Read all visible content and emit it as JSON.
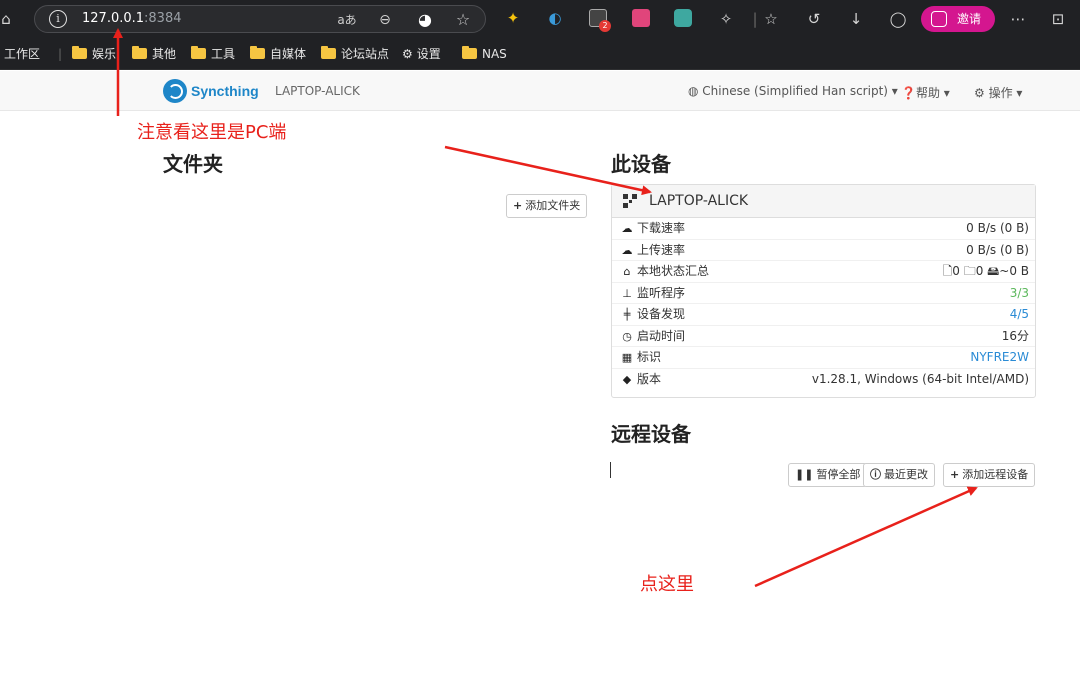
{
  "browser": {
    "url_host": "127.0.0.1",
    "url_port": ":8384",
    "invite_label": "邀请",
    "ext_badge": "2"
  },
  "bookmarks": [
    {
      "label": "工作区",
      "folder": false
    },
    {
      "label": "娱乐",
      "folder": true
    },
    {
      "label": "其他",
      "folder": true
    },
    {
      "label": "工具",
      "folder": true
    },
    {
      "label": "自媒体",
      "folder": true
    },
    {
      "label": "论坛站点",
      "folder": true
    },
    {
      "label": "设置",
      "folder": false
    },
    {
      "label": "NAS",
      "folder": true
    }
  ],
  "navbar": {
    "brand": "Syncthing",
    "device": "LAPTOP-ALICK",
    "language": "Chinese (Simplified Han script) ▾",
    "help": "帮助 ▾",
    "actions": "操作 ▾"
  },
  "folders": {
    "title": "文件夹",
    "add_button": "添加文件夹"
  },
  "this_device": {
    "title": "此设备",
    "name": "LAPTOP-ALICK",
    "rows": [
      {
        "icon": "download-cloud-icon",
        "label": "下载速率",
        "value": "0 B/s (0 B)"
      },
      {
        "icon": "upload-cloud-icon",
        "label": "上传速率",
        "value": "0 B/s (0 B)"
      },
      {
        "icon": "home-icon",
        "label": "本地状态汇总",
        "value": "🗋0  🗀0  🖴~0 B"
      },
      {
        "icon": "sitemap-icon",
        "label": "监听程序",
        "value": "3/3"
      },
      {
        "icon": "signpost-icon",
        "label": "设备发现",
        "value": "4/5"
      },
      {
        "icon": "clock-icon",
        "label": "启动时间",
        "value": "16分"
      },
      {
        "icon": "qrcode-icon",
        "label": "标识",
        "value": "NYFRE2W"
      },
      {
        "icon": "tag-icon",
        "label": "版本",
        "value": "v1.28.1, Windows (64-bit Intel/AMD)"
      }
    ]
  },
  "remote": {
    "title": "远程设备",
    "pause_all": "暂停全部",
    "recent_changes": "最近更改",
    "add_remote": "添加远程设备"
  },
  "annotations": {
    "pc_note": "注意看这里是PC端",
    "click_here": "点这里"
  },
  "colors": {
    "annotation": "#e8211b",
    "syncthing_blue": "#1e86c8",
    "invite_pink": "#d4168f",
    "ok_green": "#5cb85c",
    "link_blue": "#2a8bd5"
  }
}
